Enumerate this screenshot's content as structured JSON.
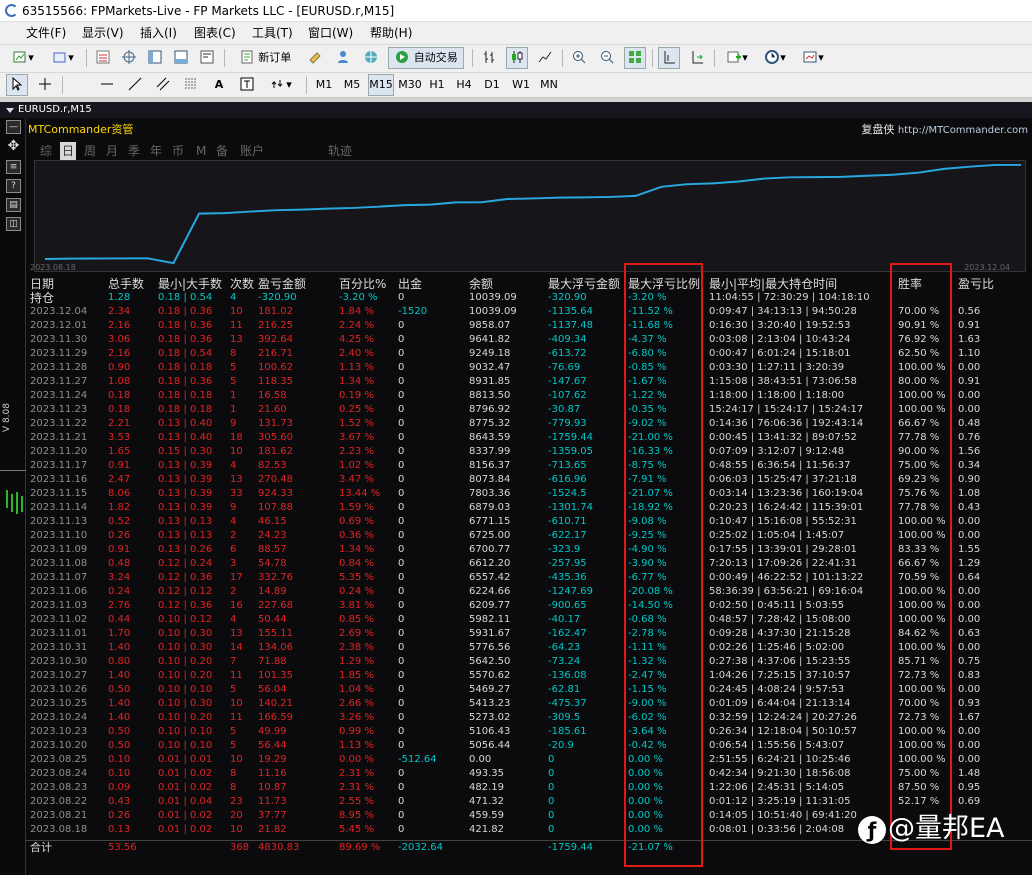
{
  "window": {
    "title": "63515566: FPMarkets-Live - FP Markets LLC - [EURUSD.r,M15]"
  },
  "menu": [
    "文件(F)",
    "显示(V)",
    "插入(I)",
    "图表(C)",
    "工具(T)",
    "窗口(W)",
    "帮助(H)"
  ],
  "toolbar": {
    "new_order": "新订单",
    "auto_trade": "自动交易",
    "timeframes": [
      "M1",
      "M5",
      "M15",
      "M30",
      "H1",
      "H4",
      "D1",
      "W1",
      "MN"
    ],
    "active_timeframe": "M15"
  },
  "chart_tab": "EURUSD.r,M15",
  "left_strip": {
    "version": "V 8.08"
  },
  "panel": {
    "title": "MTCommander资管",
    "brand": "复盘侠",
    "url": "http://MTCommander.com",
    "tabs": [
      "综",
      "日",
      "周",
      "月",
      "季",
      "年",
      "币",
      "M",
      "备",
      "账户",
      "轨迹"
    ],
    "active_tab": "日",
    "chart_start_date": "2023.08.18",
    "chart_end_date": "2023.12.04"
  },
  "equity_curve": {
    "points": [
      10039.09,
      10039.09,
      9858.07,
      9641.82,
      9249.18,
      9032.47,
      8931.85,
      8813.5,
      8796.92,
      8775.32,
      8643.59,
      8337.99,
      8156.37,
      8073.84,
      7803.36,
      6879.03,
      6771.15,
      6725,
      6700.77,
      6612.2,
      6557.42,
      6224.66,
      6209.77,
      5982.11,
      5931.67,
      5776.56,
      5642.5,
      5570.62,
      5469.27,
      5413.23,
      5273.02,
      5106.43,
      5056.44,
      0,
      493.35,
      482.19,
      471.32,
      459.59,
      421.82
    ]
  },
  "headers": [
    "日期",
    "总手数",
    "最小|大手数",
    "次数",
    "盈亏金额",
    "百分比%",
    "出金",
    "余额",
    "最大浮亏金额",
    "最大浮亏比例",
    "最小|平均|最大持仓时间",
    "胜率",
    "盈亏比"
  ],
  "holding": {
    "date": "持仓",
    "lots": "1.28",
    "minmax": "0.18 | 0.54",
    "count": "4",
    "pl": "-320.90",
    "pct": "-3.20 %",
    "wd": "0",
    "bal": "10039.09",
    "flt": "-320.90",
    "fpct": "-3.20 %",
    "time": "11:04:55 | 72:30:29 | 104:18:10",
    "win": "",
    "pr": ""
  },
  "rows": [
    {
      "date": "2023.12.04",
      "lots": "2.34",
      "minmax": "0.18 | 0.36",
      "count": "10",
      "pl": "181.02",
      "pct": "1.84 %",
      "wd": "-1520",
      "bal": "10039.09",
      "flt": "-1135.64",
      "fpct": "-11.52 %",
      "time": "0:09:47 | 34:13:13 | 94:50:28",
      "win": "70.00 %",
      "pr": "0.56"
    },
    {
      "date": "2023.12.01",
      "lots": "2.16",
      "minmax": "0.18 | 0.36",
      "count": "11",
      "pl": "216.25",
      "pct": "2.24 %",
      "wd": "0",
      "bal": "9858.07",
      "flt": "-1137.48",
      "fpct": "-11.68 %",
      "time": "0:16:30 | 3:20:40 | 19:52:53",
      "win": "90.91 %",
      "pr": "0.91"
    },
    {
      "date": "2023.11.30",
      "lots": "3.06",
      "minmax": "0.18 | 0.36",
      "count": "13",
      "pl": "392.64",
      "pct": "4.25 %",
      "wd": "0",
      "bal": "9641.82",
      "flt": "-409.34",
      "fpct": "-4.37 %",
      "time": "0:03:08 | 2:13:04 | 10:43:24",
      "win": "76.92 %",
      "pr": "1.63"
    },
    {
      "date": "2023.11.29",
      "lots": "2.16",
      "minmax": "0.18 | 0.54",
      "count": "8",
      "pl": "216.71",
      "pct": "2.40 %",
      "wd": "0",
      "bal": "9249.18",
      "flt": "-613.72",
      "fpct": "-6.80 %",
      "time": "0:00:47 | 6:01:24 | 15:18:01",
      "win": "62.50 %",
      "pr": "1.10"
    },
    {
      "date": "2023.11.28",
      "lots": "0.90",
      "minmax": "0.18 | 0.18",
      "count": "5",
      "pl": "100.62",
      "pct": "1.13 %",
      "wd": "0",
      "bal": "9032.47",
      "flt": "-76.69",
      "fpct": "-0.85 %",
      "time": "0:03:30 | 1:27:11 | 3:20:39",
      "win": "100.00 %",
      "pr": "0.00"
    },
    {
      "date": "2023.11.27",
      "lots": "1.08",
      "minmax": "0.18 | 0.36",
      "count": "5",
      "pl": "118.35",
      "pct": "1.34 %",
      "wd": "0",
      "bal": "8931.85",
      "flt": "-147.67",
      "fpct": "-1.67 %",
      "time": "1:15:08 | 38:43:51 | 73:06:58",
      "win": "80.00 %",
      "pr": "0.91"
    },
    {
      "date": "2023.11.24",
      "lots": "0.18",
      "minmax": "0.18 | 0.18",
      "count": "1",
      "pl": "16.58",
      "pct": "0.19 %",
      "wd": "0",
      "bal": "8813.50",
      "flt": "-107.62",
      "fpct": "-1.22 %",
      "time": "1:18:00 | 1:18:00 | 1:18:00",
      "win": "100.00 %",
      "pr": "0.00"
    },
    {
      "date": "2023.11.23",
      "lots": "0.18",
      "minmax": "0.18 | 0.18",
      "count": "1",
      "pl": "21.60",
      "pct": "0.25 %",
      "wd": "0",
      "bal": "8796.92",
      "flt": "-30.87",
      "fpct": "-0.35 %",
      "time": "15:24:17 | 15:24:17 | 15:24:17",
      "win": "100.00 %",
      "pr": "0.00"
    },
    {
      "date": "2023.11.22",
      "lots": "2.21",
      "minmax": "0.13 | 0.40",
      "count": "9",
      "pl": "131.73",
      "pct": "1.52 %",
      "wd": "0",
      "bal": "8775.32",
      "flt": "-779.93",
      "fpct": "-9.02 %",
      "time": "0:14:36 | 76:06:36 | 192:43:14",
      "win": "66.67 %",
      "pr": "0.48"
    },
    {
      "date": "2023.11.21",
      "lots": "3.53",
      "minmax": "0.13 | 0.40",
      "count": "18",
      "pl": "305.60",
      "pct": "3.67 %",
      "wd": "0",
      "bal": "8643.59",
      "flt": "-1759.44",
      "fpct": "-21.00 %",
      "time": "0:00:45 | 13:41:32 | 89:07:52",
      "win": "77.78 %",
      "pr": "0.76"
    },
    {
      "date": "2023.11.20",
      "lots": "1.65",
      "minmax": "0.15 | 0.30",
      "count": "10",
      "pl": "181.62",
      "pct": "2.23 %",
      "wd": "0",
      "bal": "8337.99",
      "flt": "-1359.05",
      "fpct": "-16.33 %",
      "time": "0:07:09 | 3:12:07 | 9:12:48",
      "win": "90.00 %",
      "pr": "1.56"
    },
    {
      "date": "2023.11.17",
      "lots": "0.91",
      "minmax": "0.13 | 0.39",
      "count": "4",
      "pl": "82.53",
      "pct": "1.02 %",
      "wd": "0",
      "bal": "8156.37",
      "flt": "-713.65",
      "fpct": "-8.75 %",
      "time": "0:48:55 | 6:36:54 | 11:56:37",
      "win": "75.00 %",
      "pr": "0.34"
    },
    {
      "date": "2023.11.16",
      "lots": "2.47",
      "minmax": "0.13 | 0.39",
      "count": "13",
      "pl": "270.48",
      "pct": "3.47 %",
      "wd": "0",
      "bal": "8073.84",
      "flt": "-616.96",
      "fpct": "-7.91 %",
      "time": "0:06:03 | 15:25:47 | 37:21:18",
      "win": "69.23 %",
      "pr": "0.90"
    },
    {
      "date": "2023.11.15",
      "lots": "8.06",
      "minmax": "0.13 | 0.39",
      "count": "33",
      "pl": "924.33",
      "pct": "13.44 %",
      "wd": "0",
      "bal": "7803.36",
      "flt": "-1524.5",
      "fpct": "-21.07 %",
      "time": "0:03:14 | 13:23:36 | 160:19:04",
      "win": "75.76 %",
      "pr": "1.08"
    },
    {
      "date": "2023.11.14",
      "lots": "1.82",
      "minmax": "0.13 | 0.39",
      "count": "9",
      "pl": "107.88",
      "pct": "1.59 %",
      "wd": "0",
      "bal": "6879.03",
      "flt": "-1301.74",
      "fpct": "-18.92 %",
      "time": "0:20:23 | 16:24:42 | 115:39:01",
      "win": "77.78 %",
      "pr": "0.43"
    },
    {
      "date": "2023.11.13",
      "lots": "0.52",
      "minmax": "0.13 | 0.13",
      "count": "4",
      "pl": "46.15",
      "pct": "0.69 %",
      "wd": "0",
      "bal": "6771.15",
      "flt": "-610.71",
      "fpct": "-9.08 %",
      "time": "0:10:47 | 15:16:08 | 55:52:31",
      "win": "100.00 %",
      "pr": "0.00"
    },
    {
      "date": "2023.11.10",
      "lots": "0.26",
      "minmax": "0.13 | 0.13",
      "count": "2",
      "pl": "24.23",
      "pct": "0.36 %",
      "wd": "0",
      "bal": "6725.00",
      "flt": "-622.17",
      "fpct": "-9.25 %",
      "time": "0:25:02 | 1:05:04 | 1:45:07",
      "win": "100.00 %",
      "pr": "0.00"
    },
    {
      "date": "2023.11.09",
      "lots": "0.91",
      "minmax": "0.13 | 0.26",
      "count": "6",
      "pl": "88.57",
      "pct": "1.34 %",
      "wd": "0",
      "bal": "6700.77",
      "flt": "-323.9",
      "fpct": "-4.90 %",
      "time": "0:17:55 | 13:39:01 | 29:28:01",
      "win": "83.33 %",
      "pr": "1.55"
    },
    {
      "date": "2023.11.08",
      "lots": "0.48",
      "minmax": "0.12 | 0.24",
      "count": "3",
      "pl": "54.78",
      "pct": "0.84 %",
      "wd": "0",
      "bal": "6612.20",
      "flt": "-257.95",
      "fpct": "-3.90 %",
      "time": "7:20:13 | 17:09:26 | 22:41:31",
      "win": "66.67 %",
      "pr": "1.29"
    },
    {
      "date": "2023.11.07",
      "lots": "3.24",
      "minmax": "0.12 | 0.36",
      "count": "17",
      "pl": "332.76",
      "pct": "5.35 %",
      "wd": "0",
      "bal": "6557.42",
      "flt": "-435.36",
      "fpct": "-6.77 %",
      "time": "0:00:49 | 46:22:52 | 101:13:22",
      "win": "70.59 %",
      "pr": "0.64"
    },
    {
      "date": "2023.11.06",
      "lots": "0.24",
      "minmax": "0.12 | 0.12",
      "count": "2",
      "pl": "14.89",
      "pct": "0.24 %",
      "wd": "0",
      "bal": "6224.66",
      "flt": "-1247.69",
      "fpct": "-20.08 %",
      "time": "58:36:39 | 63:56:21 | 69:16:04",
      "win": "100.00 %",
      "pr": "0.00"
    },
    {
      "date": "2023.11.03",
      "lots": "2.76",
      "minmax": "0.12 | 0.36",
      "count": "16",
      "pl": "227.68",
      "pct": "3.81 %",
      "wd": "0",
      "bal": "6209.77",
      "flt": "-900.65",
      "fpct": "-14.50 %",
      "time": "0:02:50 | 0:45:11 | 5:03:55",
      "win": "100.00 %",
      "pr": "0.00"
    },
    {
      "date": "2023.11.02",
      "lots": "0.44",
      "minmax": "0.10 | 0.12",
      "count": "4",
      "pl": "50.44",
      "pct": "0.85 %",
      "wd": "0",
      "bal": "5982.11",
      "flt": "-40.17",
      "fpct": "-0.68 %",
      "time": "0:48:57 | 7:28:42 | 15:08:00",
      "win": "100.00 %",
      "pr": "0.00"
    },
    {
      "date": "2023.11.01",
      "lots": "1.70",
      "minmax": "0.10 | 0.30",
      "count": "13",
      "pl": "155.11",
      "pct": "2.69 %",
      "wd": "0",
      "bal": "5931.67",
      "flt": "-162.47",
      "fpct": "-2.78 %",
      "time": "0:09:28 | 4:37:30 | 21:15:28",
      "win": "84.62 %",
      "pr": "0.63"
    },
    {
      "date": "2023.10.31",
      "lots": "1.40",
      "minmax": "0.10 | 0.30",
      "count": "14",
      "pl": "134.06",
      "pct": "2.38 %",
      "wd": "0",
      "bal": "5776.56",
      "flt": "-64.23",
      "fpct": "-1.11 %",
      "time": "0:02:26 | 1:25:46 | 5:02:00",
      "win": "100.00 %",
      "pr": "0.00"
    },
    {
      "date": "2023.10.30",
      "lots": "0.80",
      "minmax": "0.10 | 0.20",
      "count": "7",
      "pl": "71.88",
      "pct": "1.29 %",
      "wd": "0",
      "bal": "5642.50",
      "flt": "-73.24",
      "fpct": "-1.32 %",
      "time": "0:27:38 | 4:37:06 | 15:23:55",
      "win": "85.71 %",
      "pr": "0.75"
    },
    {
      "date": "2023.10.27",
      "lots": "1.40",
      "minmax": "0.10 | 0.20",
      "count": "11",
      "pl": "101.35",
      "pct": "1.85 %",
      "wd": "0",
      "bal": "5570.62",
      "flt": "-136.08",
      "fpct": "-2.47 %",
      "time": "1:04:26 | 7:25:15 | 37:10:57",
      "win": "72.73 %",
      "pr": "0.83"
    },
    {
      "date": "2023.10.26",
      "lots": "0.50",
      "minmax": "0.10 | 0.10",
      "count": "5",
      "pl": "56.04",
      "pct": "1.04 %",
      "wd": "0",
      "bal": "5469.27",
      "flt": "-62.81",
      "fpct": "-1.15 %",
      "time": "0:24:45 | 4:08:24 | 9:57:53",
      "win": "100.00 %",
      "pr": "0.00"
    },
    {
      "date": "2023.10.25",
      "lots": "1.40",
      "minmax": "0.10 | 0.30",
      "count": "10",
      "pl": "140.21",
      "pct": "2.66 %",
      "wd": "0",
      "bal": "5413.23",
      "flt": "-475.37",
      "fpct": "-9.00 %",
      "time": "0:01:09 | 6:44:04 | 21:13:14",
      "win": "70.00 %",
      "pr": "0.93"
    },
    {
      "date": "2023.10.24",
      "lots": "1.40",
      "minmax": "0.10 | 0.20",
      "count": "11",
      "pl": "166.59",
      "pct": "3.26 %",
      "wd": "0",
      "bal": "5273.02",
      "flt": "-309.5",
      "fpct": "-6.02 %",
      "time": "0:32:59 | 12:24:24 | 20:27:26",
      "win": "72.73 %",
      "pr": "1.67"
    },
    {
      "date": "2023.10.23",
      "lots": "0.50",
      "minmax": "0.10 | 0.10",
      "count": "5",
      "pl": "49.99",
      "pct": "0.99 %",
      "wd": "0",
      "bal": "5106.43",
      "flt": "-185.61",
      "fpct": "-3.64 %",
      "time": "0:26:34 | 12:18:04 | 50:10:57",
      "win": "100.00 %",
      "pr": "0.00"
    },
    {
      "date": "2023.10.20",
      "lots": "0.50",
      "minmax": "0.10 | 0.10",
      "count": "5",
      "pl": "56.44",
      "pct": "1.13 %",
      "wd": "0",
      "bal": "5056.44",
      "flt": "-20.9",
      "fpct": "-0.42 %",
      "time": "0:06:54 | 1:55:56 | 5:43:07",
      "win": "100.00 %",
      "pr": "0.00"
    },
    {
      "date": "2023.08.25",
      "lots": "0.10",
      "minmax": "0.01 | 0.01",
      "count": "10",
      "pl": "19.29",
      "pct": "0.00 %",
      "wd": "-512.64",
      "bal": "0.00",
      "flt": "0",
      "fpct": "0.00 %",
      "time": "2:51:55 | 6:24:21 | 10:25:46",
      "win": "100.00 %",
      "pr": "0.00"
    },
    {
      "date": "2023.08.24",
      "lots": "0.10",
      "minmax": "0.01 | 0.02",
      "count": "8",
      "pl": "11.16",
      "pct": "2.31 %",
      "wd": "0",
      "bal": "493.35",
      "flt": "0",
      "fpct": "0.00 %",
      "time": "0:42:34 | 9:21:30 | 18:56:08",
      "win": "75.00 %",
      "pr": "1.48"
    },
    {
      "date": "2023.08.23",
      "lots": "0.09",
      "minmax": "0.01 | 0.02",
      "count": "8",
      "pl": "10.87",
      "pct": "2.31 %",
      "wd": "0",
      "bal": "482.19",
      "flt": "0",
      "fpct": "0.00 %",
      "time": "1:22:06 | 2:45:31 | 5:14:05",
      "win": "87.50 %",
      "pr": "0.95"
    },
    {
      "date": "2023.08.22",
      "lots": "0.43",
      "minmax": "0.01 | 0.04",
      "count": "23",
      "pl": "11.73",
      "pct": "2.55 %",
      "wd": "0",
      "bal": "471.32",
      "flt": "0",
      "fpct": "0.00 %",
      "time": "0:01:12 | 3:25:19 | 11:31:05",
      "win": "52.17 %",
      "pr": "0.69"
    },
    {
      "date": "2023.08.21",
      "lots": "0.26",
      "minmax": "0.01 | 0.02",
      "count": "20",
      "pl": "37.77",
      "pct": "8.95 %",
      "wd": "0",
      "bal": "459.59",
      "flt": "0",
      "fpct": "0.00 %",
      "time": "0:14:05 | 10:51:40 | 69:41:20",
      "win": "",
      "pr": ""
    },
    {
      "date": "2023.08.18",
      "lots": "0.13",
      "minmax": "0.01 | 0.02",
      "count": "10",
      "pl": "21.82",
      "pct": "5.45 %",
      "wd": "0",
      "bal": "421.82",
      "flt": "0",
      "fpct": "0.00 %",
      "time": "0:08:01 | 0:33:56 | 2:04:08",
      "win": "",
      "pr": ""
    }
  ],
  "totals": {
    "date": "合计",
    "lots": "53.56",
    "minmax": "",
    "count": "368",
    "pl": "4830.83",
    "pct": "89.69 %",
    "wd": "-2032.64",
    "bal": "",
    "flt": "-1759.44",
    "fpct": "-21.07 %",
    "time": "",
    "win": "",
    "pr": ""
  },
  "watermark": "@量邦EA",
  "colors": {
    "profit_red": "#e02424",
    "cyan": "#00c8c8",
    "curve": "#29a8e0",
    "highlight_box": "#e01818",
    "title_yellow": "#ffd700"
  }
}
